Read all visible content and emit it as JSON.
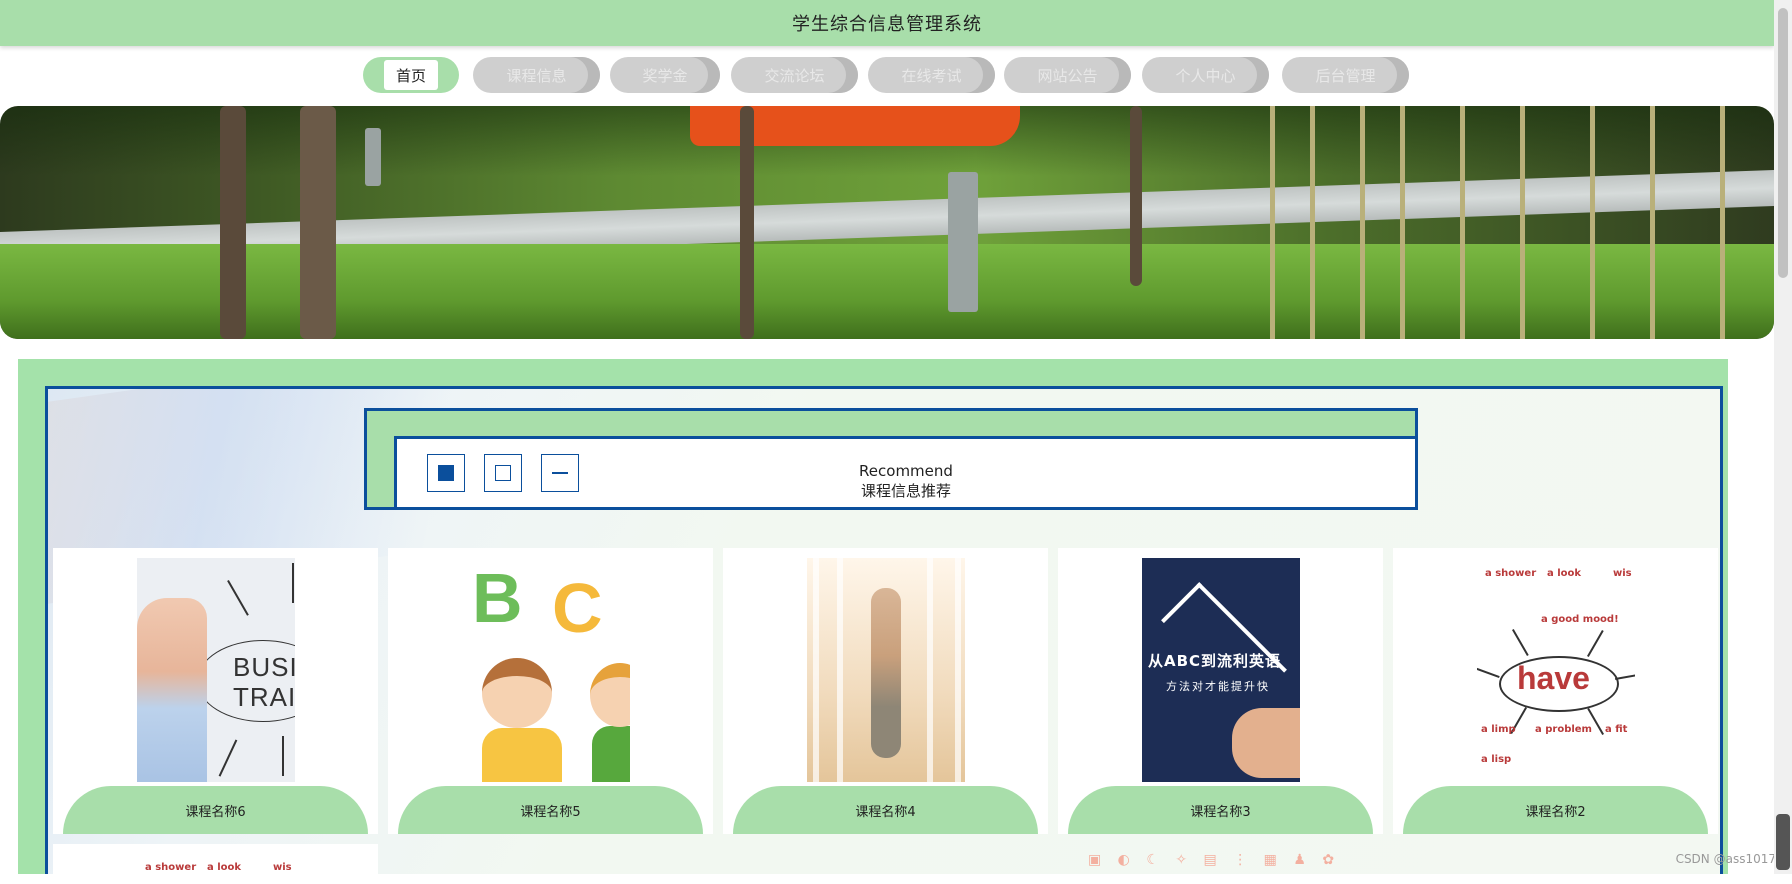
{
  "header": {
    "title": "学生综合信息管理系统"
  },
  "nav": {
    "items": [
      {
        "label": "首页",
        "active": true
      },
      {
        "label": "课程信息"
      },
      {
        "label": "奖学金"
      },
      {
        "label": "交流论坛"
      },
      {
        "label": "在线考试"
      },
      {
        "label": "网站公告"
      },
      {
        "label": "个人中心"
      },
      {
        "label": "后台管理"
      }
    ]
  },
  "recommend": {
    "title_en": "Recommend",
    "title_cn": "课程信息推荐"
  },
  "courses": [
    {
      "name": "课程名称6",
      "thumb_text": "BUSIN TRAIN"
    },
    {
      "name": "课程名称5",
      "thumb_text_1": "B",
      "thumb_text_2": "C"
    },
    {
      "name": "课程名称4"
    },
    {
      "name": "课程名称3",
      "thumb_text_1": "从ABC到流利英语",
      "thumb_text_2": "方法对才能提升快"
    },
    {
      "name": "课程名称2",
      "thumb_text": "have",
      "labels": [
        "a shower",
        "a look",
        "wis",
        "a good mood!",
        "a limp",
        "a problem",
        "a fit",
        "a lisp"
      ]
    }
  ],
  "partial_card": {
    "labels": [
      "a shower",
      "a look",
      "wis"
    ]
  },
  "watermark": "CSDN @ass1017",
  "colors": {
    "accent_green": "#a8deaa",
    "border_blue": "#0b4f9c"
  }
}
